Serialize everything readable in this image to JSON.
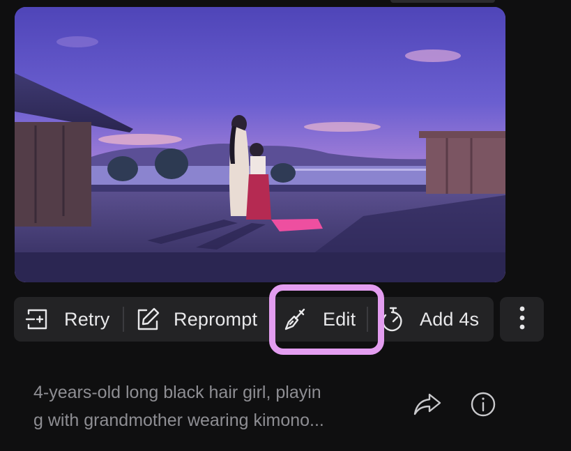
{
  "toolbar": {
    "retry_label": "Retry",
    "reprompt_label": "Reprompt",
    "edit_label": "Edit",
    "add_label": "Add 4s"
  },
  "caption": {
    "line1": "4-years-old long black hair girl, playin",
    "line2": "g with grandmother wearing kimono..."
  },
  "icons": {
    "retry": "retry-icon",
    "reprompt": "pencil-square-icon",
    "edit": "brush-icon",
    "add": "timer-icon",
    "more": "more-vertical-icon",
    "share": "share-arrow-icon",
    "info": "info-icon"
  },
  "colors": {
    "highlight": "#e39df0",
    "toolbar_bg": "#232325",
    "page_bg": "#0f0f10"
  }
}
